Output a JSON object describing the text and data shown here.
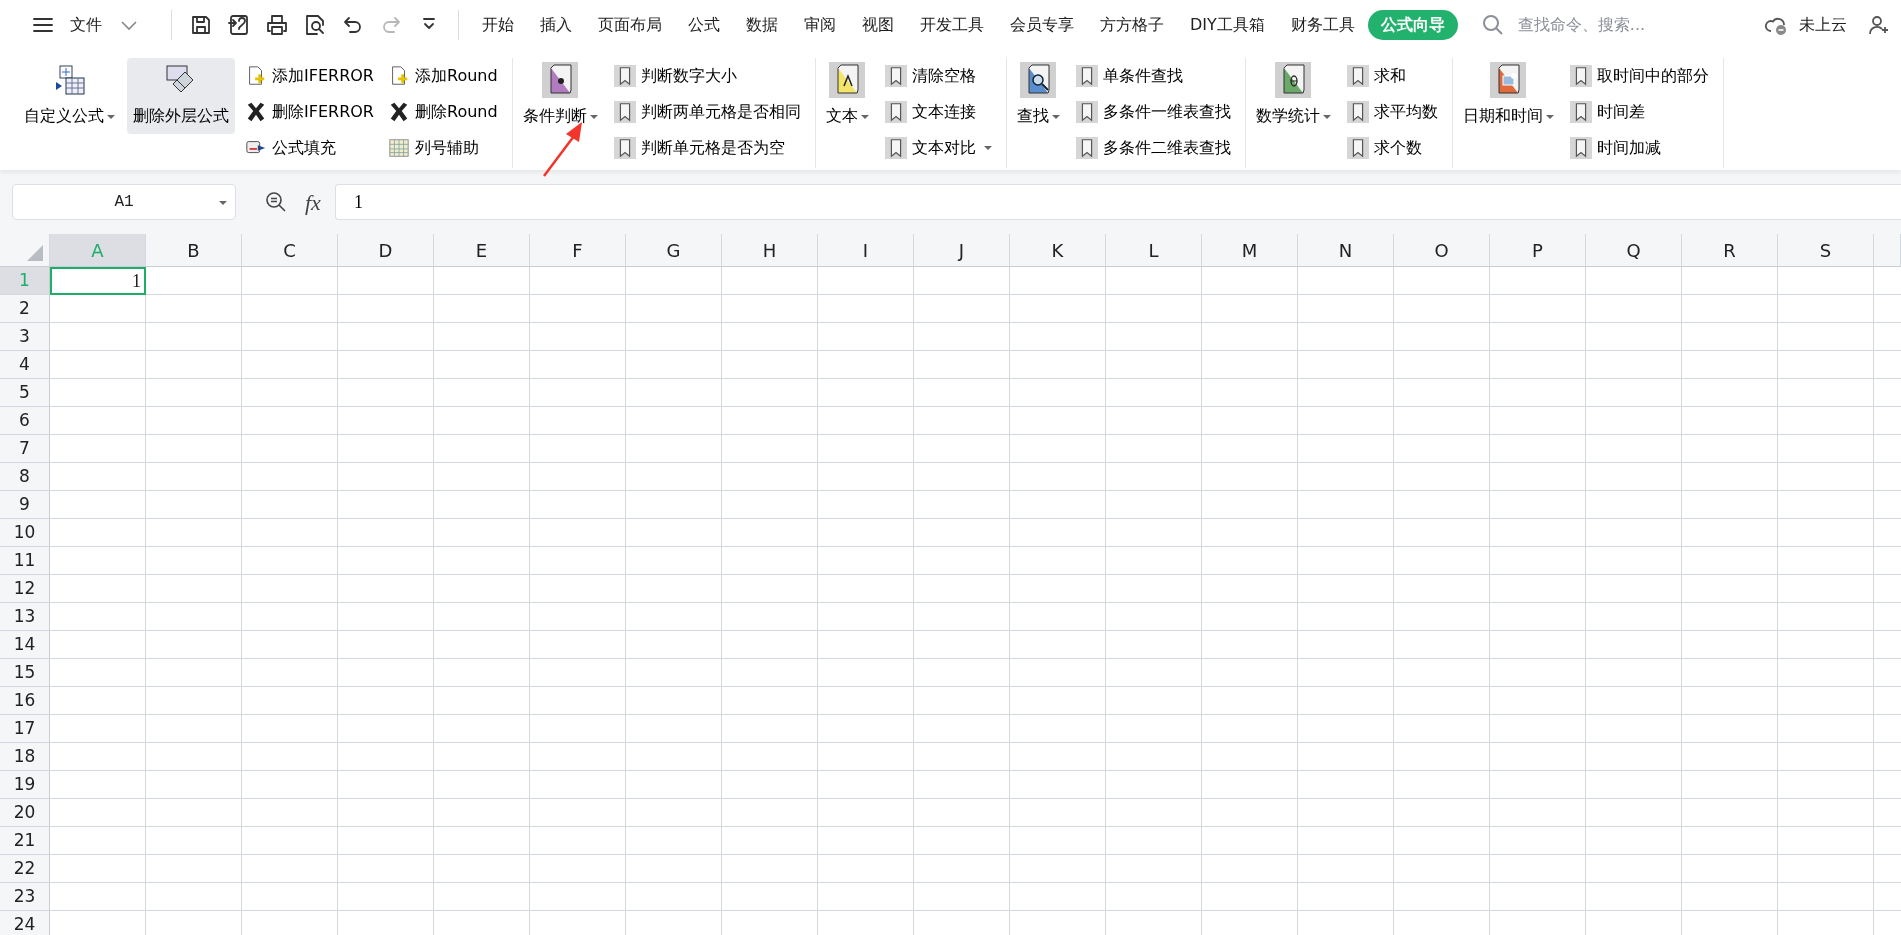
{
  "file_menu": {
    "label": "文件"
  },
  "quick_access": [
    {
      "kind": "save",
      "disabled": false
    },
    {
      "kind": "export",
      "disabled": false
    },
    {
      "kind": "print",
      "disabled": false
    },
    {
      "kind": "preview",
      "disabled": false
    },
    {
      "kind": "undo",
      "disabled": false
    },
    {
      "kind": "redo",
      "disabled": true
    },
    {
      "kind": "more",
      "disabled": false
    }
  ],
  "tabs": [
    {
      "label": "开始",
      "selected": false
    },
    {
      "label": "插入",
      "selected": false
    },
    {
      "label": "页面布局",
      "selected": false
    },
    {
      "label": "公式",
      "selected": false
    },
    {
      "label": "数据",
      "selected": false
    },
    {
      "label": "审阅",
      "selected": false
    },
    {
      "label": "视图",
      "selected": false
    },
    {
      "label": "开发工具",
      "selected": false
    },
    {
      "label": "会员专享",
      "selected": false
    },
    {
      "label": "方方格子",
      "selected": false
    },
    {
      "label": "DIY工具箱",
      "selected": false
    },
    {
      "label": "财务工具",
      "selected": false
    },
    {
      "label": "公式向导",
      "selected": true
    }
  ],
  "search": {
    "placeholder": "查找命令、搜索..."
  },
  "cloud_status": "未上云",
  "ribbon_groups": [
    {
      "large": [
        {
          "label": "自定义公式",
          "kind": "table",
          "dropdown": true,
          "highlighted": false
        },
        {
          "label": "删除外层公式",
          "kind": "eraser",
          "dropdown": false,
          "highlighted": true
        }
      ],
      "columns": [
        [
          {
            "label": "添加IFERROR",
            "kind": "add",
            "dropdown": false
          },
          {
            "label": "删除IFERROR",
            "kind": "remove",
            "dropdown": false
          },
          {
            "label": "公式填充",
            "kind": "fill",
            "dropdown": false
          }
        ],
        [
          {
            "label": "添加Round",
            "kind": "add",
            "dropdown": false
          },
          {
            "label": "删除Round",
            "kind": "remove",
            "dropdown": false
          },
          {
            "label": "列号辅助",
            "kind": "grid",
            "dropdown": false
          }
        ]
      ]
    },
    {
      "large": [
        {
          "label": "条件判断",
          "kind": "question",
          "dropdown": true,
          "highlighted": false
        }
      ],
      "columns": [
        [
          {
            "label": "判断数字大小",
            "kind": "bookmark",
            "dropdown": false
          },
          {
            "label": "判断两单元格是否相同",
            "kind": "bookmark",
            "dropdown": false
          },
          {
            "label": "判断单元格是否为空",
            "kind": "bookmark",
            "dropdown": false
          }
        ]
      ]
    },
    {
      "large": [
        {
          "label": "文本",
          "kind": "letter",
          "dropdown": true,
          "highlighted": false
        }
      ],
      "columns": [
        [
          {
            "label": "清除空格",
            "kind": "bookmark",
            "dropdown": false
          },
          {
            "label": "文本连接",
            "kind": "bookmark",
            "dropdown": false
          },
          {
            "label": "文本对比",
            "kind": "bookmark",
            "dropdown": true
          }
        ]
      ]
    },
    {
      "large": [
        {
          "label": "查找",
          "kind": "search",
          "dropdown": true,
          "highlighted": false
        }
      ],
      "columns": [
        [
          {
            "label": "单条件查找",
            "kind": "bookmark",
            "dropdown": false
          },
          {
            "label": "多条件一维表查找",
            "kind": "bookmark",
            "dropdown": false
          },
          {
            "label": "多条件二维表查找",
            "kind": "bookmark",
            "dropdown": false
          }
        ]
      ]
    },
    {
      "large": [
        {
          "label": "数学统计",
          "kind": "math",
          "dropdown": true,
          "highlighted": false
        }
      ],
      "columns": [
        [
          {
            "label": "求和",
            "kind": "bookmark",
            "dropdown": false
          },
          {
            "label": "求平均数",
            "kind": "bookmark",
            "dropdown": false
          },
          {
            "label": "求个数",
            "kind": "bookmark",
            "dropdown": false
          }
        ]
      ]
    },
    {
      "large": [
        {
          "label": "日期和时间",
          "kind": "calendar",
          "dropdown": true,
          "highlighted": false
        }
      ],
      "columns": [
        [
          {
            "label": "取时间中的部分",
            "kind": "bookmark",
            "dropdown": false
          },
          {
            "label": "时间差",
            "kind": "bookmark",
            "dropdown": false
          },
          {
            "label": "时间加减",
            "kind": "bookmark",
            "dropdown": false
          }
        ]
      ]
    }
  ],
  "formula_bar": {
    "name_box": "A1",
    "function_label": "fx",
    "value": "1"
  },
  "sheet": {
    "columns": [
      {
        "label": "A",
        "selected": true
      },
      {
        "label": "B",
        "selected": false
      },
      {
        "label": "C",
        "selected": false
      },
      {
        "label": "D",
        "selected": false
      },
      {
        "label": "E",
        "selected": false
      },
      {
        "label": "F",
        "selected": false
      },
      {
        "label": "G",
        "selected": false
      },
      {
        "label": "H",
        "selected": false
      },
      {
        "label": "I",
        "selected": false
      },
      {
        "label": "J",
        "selected": false
      },
      {
        "label": "K",
        "selected": false
      },
      {
        "label": "L",
        "selected": false
      },
      {
        "label": "M",
        "selected": false
      },
      {
        "label": "N",
        "selected": false
      },
      {
        "label": "O",
        "selected": false
      },
      {
        "label": "P",
        "selected": false
      },
      {
        "label": "Q",
        "selected": false
      },
      {
        "label": "R",
        "selected": false
      },
      {
        "label": "S",
        "selected": false
      }
    ],
    "rows": [
      {
        "label": "1",
        "selected": true,
        "cells": [
          "1"
        ]
      },
      {
        "label": "2",
        "selected": false
      },
      {
        "label": "3",
        "selected": false
      },
      {
        "label": "4",
        "selected": false
      },
      {
        "label": "5",
        "selected": false
      },
      {
        "label": "6",
        "selected": false
      },
      {
        "label": "7",
        "selected": false
      },
      {
        "label": "8",
        "selected": false
      },
      {
        "label": "9",
        "selected": false
      },
      {
        "label": "10",
        "selected": false
      },
      {
        "label": "11",
        "selected": false
      },
      {
        "label": "12",
        "selected": false
      },
      {
        "label": "13",
        "selected": false
      },
      {
        "label": "14",
        "selected": false
      },
      {
        "label": "15",
        "selected": false
      },
      {
        "label": "16",
        "selected": false
      },
      {
        "label": "17",
        "selected": false
      },
      {
        "label": "18",
        "selected": false
      },
      {
        "label": "19",
        "selected": false
      },
      {
        "label": "20",
        "selected": false
      },
      {
        "label": "21",
        "selected": false
      },
      {
        "label": "22",
        "selected": false
      },
      {
        "label": "23",
        "selected": false
      },
      {
        "label": "24",
        "selected": false
      }
    ]
  },
  "annotations": [
    {
      "kind": "arrow"
    }
  ]
}
